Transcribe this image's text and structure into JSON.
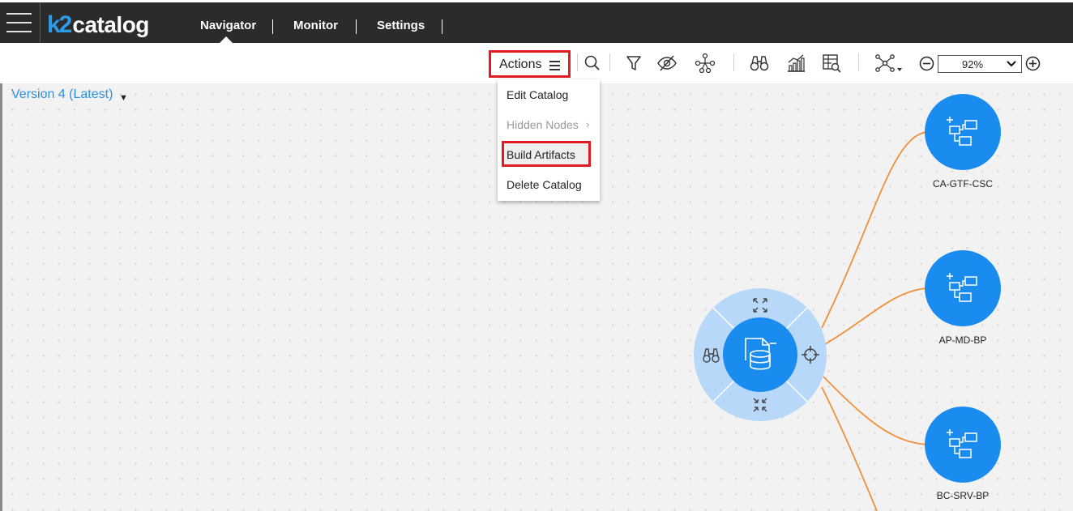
{
  "app": {
    "logo_k2": "k2",
    "logo_text": "catalog"
  },
  "nav": {
    "items": [
      {
        "label": "Navigator",
        "active": true
      },
      {
        "label": "Monitor",
        "active": false
      },
      {
        "label": "Settings",
        "active": false
      }
    ]
  },
  "toolbar": {
    "actions_label": "Actions",
    "icons": [
      "search-icon",
      "filter-icon",
      "hide-icon",
      "network-icon",
      "binoculars-icon",
      "chart-icon",
      "table-search-icon",
      "graph-layout-icon"
    ],
    "zoom_value": "92%"
  },
  "canvas": {
    "version_label": "Version 4 (Latest)"
  },
  "actions_menu": {
    "items": [
      {
        "label": "Edit Catalog",
        "enabled": true
      },
      {
        "label": "Hidden Nodes",
        "enabled": false,
        "submenu": true
      },
      {
        "label": "Build Artifacts",
        "enabled": true,
        "highlighted": true
      },
      {
        "label": "Delete Catalog",
        "enabled": true
      }
    ]
  },
  "graph": {
    "center_node": {
      "icon": "database-file-icon",
      "ring_actions": [
        "expand-icon",
        "locate-icon",
        "collapse-icon",
        "binoculars-icon"
      ]
    },
    "nodes": [
      {
        "label": "CA-GTF-CSC"
      },
      {
        "label": "AP-MD-BP"
      },
      {
        "label": "BC-SRV-BP"
      }
    ]
  },
  "colors": {
    "accent": "#1a8cf0",
    "edge": "#f0903a",
    "highlight": "#e11b22",
    "topbar": "#2b2b2b"
  }
}
